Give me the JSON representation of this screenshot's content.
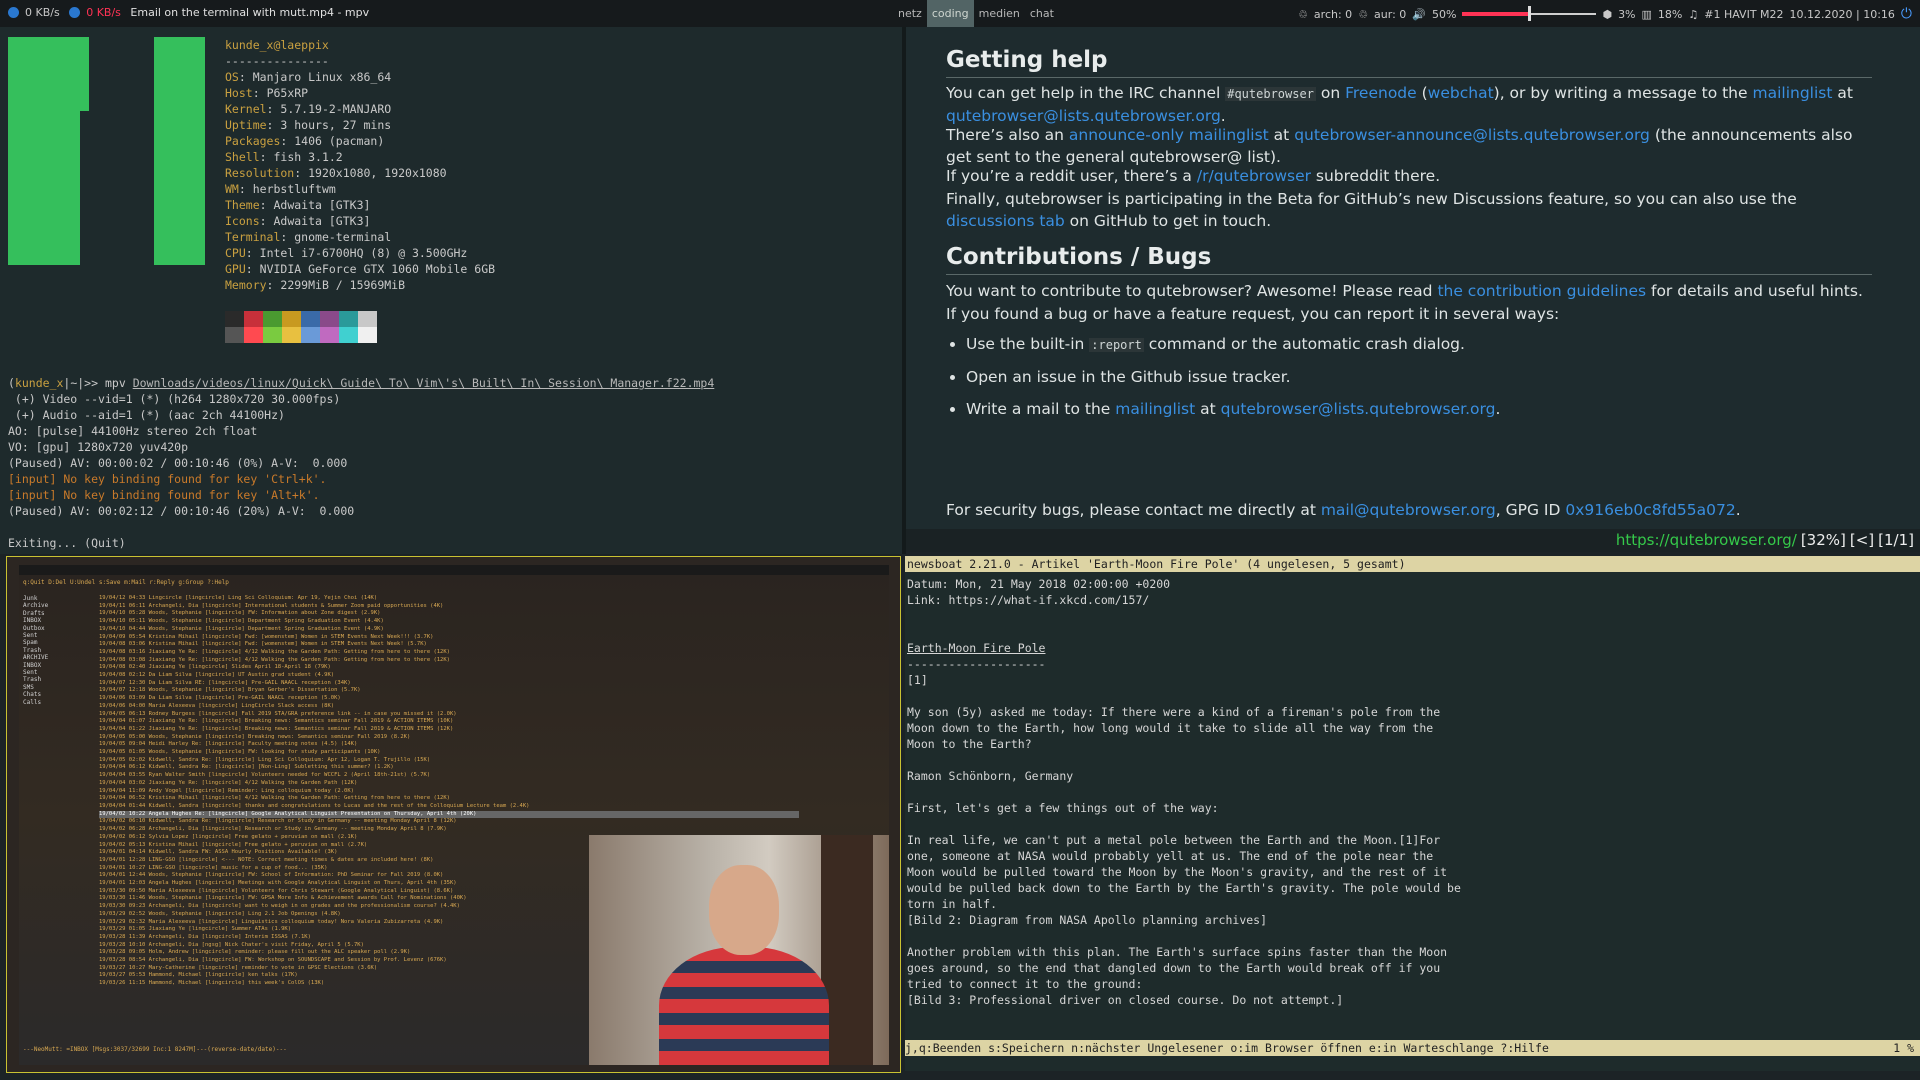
{
  "topbar": {
    "down_rate": "0 KB/s",
    "up_rate": "0 KB/s",
    "window_title": "Email on the terminal with mutt.mp4 - mpv",
    "tags": [
      "netz",
      "coding",
      "medien",
      "chat"
    ],
    "active_tag": "coding",
    "arch": "arch: 0",
    "aur": "aur: 0",
    "volume": "50%",
    "volume_level": 0.5,
    "cpu": "3%",
    "mem": "18%",
    "headset": "#1 HAVIT M22",
    "datetime": "10.12.2020 | 10:16"
  },
  "terminal": {
    "user_host": "kunde_x@laeppix",
    "separator": "---------------",
    "info": [
      {
        "k": "OS",
        "v": "Manjaro Linux x86_64"
      },
      {
        "k": "Host",
        "v": "P65xRP"
      },
      {
        "k": "Kernel",
        "v": "5.7.19-2-MANJARO"
      },
      {
        "k": "Uptime",
        "v": "3 hours, 27 mins"
      },
      {
        "k": "Packages",
        "v": "1406 (pacman)"
      },
      {
        "k": "Shell",
        "v": "fish 3.1.2"
      },
      {
        "k": "Resolution",
        "v": "1920x1080, 1920x1080"
      },
      {
        "k": "WM",
        "v": "herbstluftwm"
      },
      {
        "k": "Theme",
        "v": "Adwaita [GTK3]"
      },
      {
        "k": "Icons",
        "v": "Adwaita [GTK3]"
      },
      {
        "k": "Terminal",
        "v": "gnome-terminal"
      },
      {
        "k": "CPU",
        "v": "Intel i7-6700HQ (8) @ 3.500GHz"
      },
      {
        "k": "GPU",
        "v": "NVIDIA GeForce GTX 1060 Mobile 6GB"
      },
      {
        "k": "Memory",
        "v": "2299MiB / 15969MiB"
      }
    ],
    "swatch_top": [
      "#2a2a2a",
      "#c8303a",
      "#4a9a30",
      "#c89a20",
      "#3a6aa8",
      "#8a4a8a",
      "#2a9a9a",
      "#c8c8c8"
    ],
    "swatch_bottom": [
      "#555555",
      "#ff4a50",
      "#7acb40",
      "#e8c040",
      "#6a9ad8",
      "#c06ac0",
      "#40d0d0",
      "#f0f0f0"
    ],
    "prompt_user": "kunde_x",
    "prompt_rest": "|~|>",
    "command": "mpv",
    "command_arg": "Downloads/videos/linux/Quick\\ Guide\\ To\\ Vim\\'s\\ Built\\ In\\ Session\\ Manager.f22.mp4",
    "output": [
      " (+) Video --vid=1 (*) (h264 1280x720 30.000fps)",
      " (+) Audio --aid=1 (*) (aac 2ch 44100Hz)",
      "AO: [pulse] 44100Hz stereo 2ch float",
      "VO: [gpu] 1280x720 yuv420p",
      "(Paused) AV: 00:00:02 / 00:10:46 (0%) A-V:  0.000"
    ],
    "warnings": [
      "[input] No key binding found for key 'Ctrl+k'.",
      "[input] No key binding found for key 'Alt+k'."
    ],
    "output2": "(Paused) AV: 00:02:12 / 00:10:46 (20%) A-V:  0.000",
    "exiting": "Exiting... (Quit)"
  },
  "mutt": {
    "header": "q:Quit  D:Del  U:Undel  s:Save  m:Mail  r:Reply  g:Group  ?:Help",
    "sidebar": [
      "Junk",
      "Archive",
      "Drafts",
      "INBOX",
      "Outbox",
      "Sent",
      "Spam",
      "Trash",
      "ARCHIVE",
      "INBOX",
      "Sent",
      "Trash",
      "SMS",
      "Chats",
      "Calls"
    ],
    "rows": [
      "19/04/12 04:33  Lingcircle  [lingcircle] Ling Sci Colloquium: Apr 19, Yejin Choi (14K)",
      "19/04/11 06:11  Archangeli, Dia  [lingcircle] International students & Summer Zoom paid opportunities (4K)",
      "19/04/10 05:28  Woods, Stephanie  [lingcircle] FW: Information about Zone digest (2.9K)",
      "19/04/10 05:11  Woods, Stephanie  [lingcircle] Department Spring Graduation Event (4.4K)",
      "19/04/10 04:44  Woods, Stephanie  [lingcircle] Department Spring Graduation Event (4.9K)",
      "19/04/09 05:54  Kristina Mihail  [lingcircle] Fwd: [womenstem] Women in STEM Events Next Week!!! (3.7K)",
      "19/04/08 03:06  Kristina Mihail  [lingcircle] Fwd: [womenstem] Women in STEM Events Next Week! (5.7K)",
      "19/04/08 03:16  Jiaxiang Ye  Re: [lingcircle] 4/12 Walking the Garden Path: Getting from here to there (12K)",
      "19/04/08 03:08  Jiaxiang Ye  Re: [lingcircle] 4/12 Walking the Garden Path: Getting from here to there (12K)",
      "19/04/08 02:40  Jiaxiang Ye  [lingcircle] Slides April 18-April 18 (79K)",
      "19/04/08 02:12  Da Liam Silva  [lingcircle] UT Austin grad student (4.9K)",
      "19/04/07 12:30  Da Liam Silva  RE: [lingcircle] Pre-GAIL NAACL reception (34K)",
      "19/04/07 12:18  Woods, Stephanie  [lingcircle] Bryan Gerber's Dissertation (5.7K)",
      "19/04/06 03:09  Da Liam Silva  [lingcircle] Pre-GAIL NAACL reception (5.0K)",
      "19/04/06 04:00  Maria Alexeeva  [lingcircle] LingCircle Slack access (8K)",
      "19/04/05 06:13  Rodney Burgess  [lingcircle] Fall 2019 STA/GRA preference link -- in case you missed it (2.0K)",
      "19/04/04 01:07  Jiaxiang Ye  Re: [lingcircle] Breaking news: Semantics seminar Fall 2019 & ACTION ITEMS (10K)",
      "19/04/04 01:22  Jiaxiang Ye  Re: [lingcircle] Breaking news: Semantics seminar Fall 2019 & ACTION ITEMS (12K)",
      "19/04/05 05:00  Woods, Stephanie  [lingcircle] Breaking news: Semantics seminar Fall 2019 (8.2K)",
      "19/04/05 09:04  Heidi Harley  Re: [lingcircle] Faculty meeting notes (4.5) (14K)",
      "19/04/05 01:05  Woods, Stephanie  [lingcircle] FW: looking for study participants (10K)",
      "19/04/05 02:02  Kidwell, Sandra  Re: [lingcircle] Ling Sci Colloquium: Apr 12, Logan T. Trujillo (15K)",
      "19/04/04 06:12  Kidwell, Sandra  Re: [lingcircle] [Non-Ling] Subletting this summer? (1.2K)",
      "19/04/04 03:55  Ryan Walter Smith  [lingcircle] Volunteers needed for WCCFL 2 (April 18th-21st) (5.7K)",
      "19/04/04 03:02  Jiaxiang Ye  Re: [lingcircle] 4/12 Walking the Garden Path (12K)",
      "19/04/04 11:09  Andy Vogel  [lingcircle] Reminder: Ling colloquium today (2.0K)",
      "19/04/04 06:52  Kristina Mihail  [lingcircle] 4/12 Walking the Garden Path: Getting from here to there (12K)",
      "19/04/04 01:44  Kidwell, Sandra  [lingcircle] thanks and congratulations to Lucas and the rest of the Colloquium Lecture team (2.4K)",
      "19/04/02 10:22  Angela Hughes  Re: [lingcircle] Google Analytical Linguist Presentation on Thursday, April 4th (20K)",
      "19/04/02 06:10  Kidwell, Sandra  Re: [lingcircle] Research or Study in Germany -- meeting Monday April 8 (12K)",
      "19/04/02 06:28  Archangeli, Dia  [lingcircle] Research or Study in Germany -- meeting Monday April 8 (7.9K)",
      "19/04/02 06:12  Sylvia Lopez  [lingcircle] Free gelato + peruvian on mall (2.1K)",
      "19/04/02 05:13  Kristina Mihail  [lingcircle] Free gelato + peruvian on mall (2.7K)",
      "19/04/01 04:14  Kidwell, Sandra  FW: ASSA Hourly Positions Available! (3K)",
      "19/04/01 12:28  LING-GSO  [lingcircle] <--- NOTE: Correct meeting times & dates are included here! (8K)",
      "19/04/01 10:27  LING-GSO  [lingcircle] music for a cup of food... (35K)",
      "19/04/01 12:44  Woods, Stephanie  [lingcircle] FW: School of Information: PhD Seminar for Fall 2019 (8.0K)",
      "19/04/01 12:03  Angela Hughes  [lingcircle] Meetings with Google Analytical Linguist on Thurs, April 4th (35K)",
      "19/03/30 09:50  Maria Alexeeva  [lingcircle] Volunteers for Chris Stewart (Google Analytical Linguist) (8.6K)",
      "19/03/30 11:46  Woods, Stephanie  [lingcircle] FW: GPSA More Info & Achievement awards Call for Nominations (40K)",
      "19/03/30 09:23  Archangeli, Dia  [lingcircle] want to weigh in on grades and the professionalism course? (4.4K)",
      "19/03/29 02:52  Woods, Stephanie  [lingcircle] Ling 2.1 Job Openings (4.8K)",
      "19/03/29 02:32  Maria Alexeeva  [lingcircle] Linguistics colloquium today! Nora Valeria Zubizarreta (4.9K)",
      "19/03/29 01:05  Jiaxiang Ye  [lingcircle] Summer ATAs (1.9K)",
      "19/03/28 11:39  Archangeli, Dia  [lingcircle] Interim ISSAS (7.1K)",
      "19/03/28 10:10  Archangeli, Dia  [ngsg] Nick Chater's visit Friday, April 5 (5.7K)",
      "19/03/28 09:05  Holm, Andrew  [lingcircle] reminder: please fill out the ALC speaker poll (2.9K)",
      "19/03/28 08:54  Archangeli, Dia  [lingcircle] FW: Workshop on SOUNDSCAPE and Session by Prof. Levenz (676K)",
      "19/03/27 10:27  Mary-Catherine  [lingcircle] reminder to vote in GPSC Elections (3.6K)",
      "19/03/27 05:53  Hammond, Michael  [lingcircle] ken talks (17K)",
      "19/03/26 11:15  Hammond, Michael  [lingcircle] this week's ColOS (13K)"
    ],
    "selected_row_index": 28,
    "status": "---NeoMutt: =INBOX [Msgs:3037/32699 Inc:1 8247M]---(reverse-date/date)---"
  },
  "browser": {
    "heading1": "Getting help",
    "p1": [
      {
        "t": "You can get help in the IRC channel "
      },
      {
        "code": "#qutebrowser"
      },
      {
        "t": " on "
      },
      {
        "a": "Freenode"
      },
      {
        "t": " ("
      },
      {
        "a": "webchat"
      },
      {
        "t": "), or by writing a message to the "
      },
      {
        "a": "mailinglist"
      },
      {
        "t": " at "
      },
      {
        "a": "qutebrowser@lists.qutebrowser.org"
      },
      {
        "t": "."
      }
    ],
    "p2": [
      {
        "t": "There’s also an "
      },
      {
        "a": "announce-only mailinglist"
      },
      {
        "t": " at "
      },
      {
        "a": "qutebrowser-announce@lists.qutebrowser.org"
      },
      {
        "t": " (the announcements also get sent to the general qutebrowser@ list)."
      }
    ],
    "p3": [
      {
        "t": "If you’re a reddit user, there’s a "
      },
      {
        "a": "/r/qutebrowser"
      },
      {
        "t": " subreddit there."
      }
    ],
    "p4": [
      {
        "t": "Finally, qutebrowser is participating in the Beta for GitHub’s new Discussions feature, so you can also use the "
      },
      {
        "a": "discussions tab"
      },
      {
        "t": " on GitHub to get in touch."
      }
    ],
    "heading2": "Contributions / Bugs",
    "p5": [
      {
        "t": "You want to contribute to qutebrowser? Awesome! Please read "
      },
      {
        "a": "the contribution guidelines"
      },
      {
        "t": " for details and useful hints."
      }
    ],
    "p6": [
      {
        "t": "If you found a bug or have a feature request, you can report it in several ways:"
      }
    ],
    "bullets": [
      [
        {
          "t": "Use the built-in "
        },
        {
          "code": ":report"
        },
        {
          "t": " command or the automatic crash dialog."
        }
      ],
      [
        {
          "t": "Open an issue in the Github issue tracker."
        }
      ],
      [
        {
          "t": "Write a mail to the "
        },
        {
          "a": "mailinglist"
        },
        {
          "t": " at "
        },
        {
          "a": "qutebrowser@lists.qutebrowser.org"
        },
        {
          "t": "."
        }
      ]
    ],
    "p7": [
      {
        "t": "For security bugs, please contact me directly at "
      },
      {
        "a": "mail@qutebrowser.org"
      },
      {
        "t": ", GPG ID "
      },
      {
        "a": "0x916eb0c8fd55a072"
      },
      {
        "t": "."
      }
    ],
    "status_url": "https://qutebrowser.org/",
    "status_pct": "[32%]",
    "status_back": "[<]",
    "status_tabs": "[1/1]"
  },
  "newsboat": {
    "title": "newsboat 2.21.0 - Artikel 'Earth-Moon Fire Pole' (4 ungelesen, 5 gesamt)",
    "date": "Datum: Mon, 21 May 2018 02:00:00 +0200",
    "link": "Link: https://what-if.xkcd.com/157/",
    "article_title": "Earth-Moon Fire Pole",
    "underline": "--------------------",
    "ref": "[1]",
    "para1": "My son (5y) asked me today: If there were a kind of a fireman's pole from the\nMoon down to the Earth, how long would it take to slide all the way from the\nMoon to the Earth?",
    "author": "Ramon Schönborn, Germany",
    "para2": "First, let's get a few things out of the way:",
    "para3": "In real life, we can't put a metal pole between the Earth and the Moon.[1]For\none, someone at NASA would probably yell at us. The end of the pole near the\nMoon would be pulled toward the Moon by the Moon's gravity, and the rest of it\nwould be pulled back down to the Earth by the Earth's gravity. The pole would be\ntorn in half.",
    "img2": "[Bild 2: Diagram from NASA Apollo planning archives]",
    "para4": "Another problem with this plan. The Earth's surface spins faster than the Moon\ngoes around, so the end that dangled down to the Earth would break off if you\ntried to connect it to the ground:",
    "img3": "[Bild 3: Professional driver on closed course. Do not attempt.]",
    "footer": "j,q:Beenden s:Speichern n:nächster Ungelesener o:im Browser öffnen e:in Warteschlange ?:Hilfe",
    "footer_pct": "1 %"
  }
}
